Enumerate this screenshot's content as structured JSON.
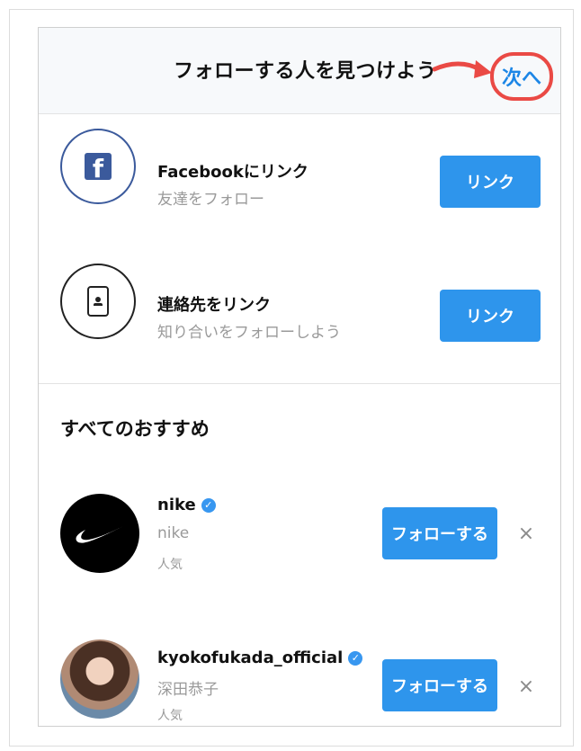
{
  "header": {
    "title": "フォローする人を見つけよう",
    "next_label": "次へ",
    "accent_color": "#ea4a45"
  },
  "connect_rows": [
    {
      "icon": "facebook-icon",
      "title": "Facebookにリンク",
      "subtitle": "友達をフォロー",
      "button_label": "リンク"
    },
    {
      "icon": "contact-card-icon",
      "title": "連絡先をリンク",
      "subtitle": "知り合いをフォローしよう",
      "button_label": "リンク"
    }
  ],
  "suggestions": {
    "section_title": "すべてのおすすめ",
    "users": [
      {
        "username": "nike",
        "display_name": "nike",
        "tag": "人気",
        "verified": true,
        "follow_label": "フォローする",
        "dismiss_glyph": "×"
      },
      {
        "username": "kyokofukada_official",
        "display_name": "深田恭子",
        "tag": "人気",
        "verified": true,
        "follow_label": "フォローする",
        "dismiss_glyph": "×"
      }
    ]
  },
  "colors": {
    "primary_button": "#2e95ec",
    "link_text": "#1c86e6",
    "verified_badge": "#3897f0",
    "facebook_brand": "#3b5a9c"
  }
}
